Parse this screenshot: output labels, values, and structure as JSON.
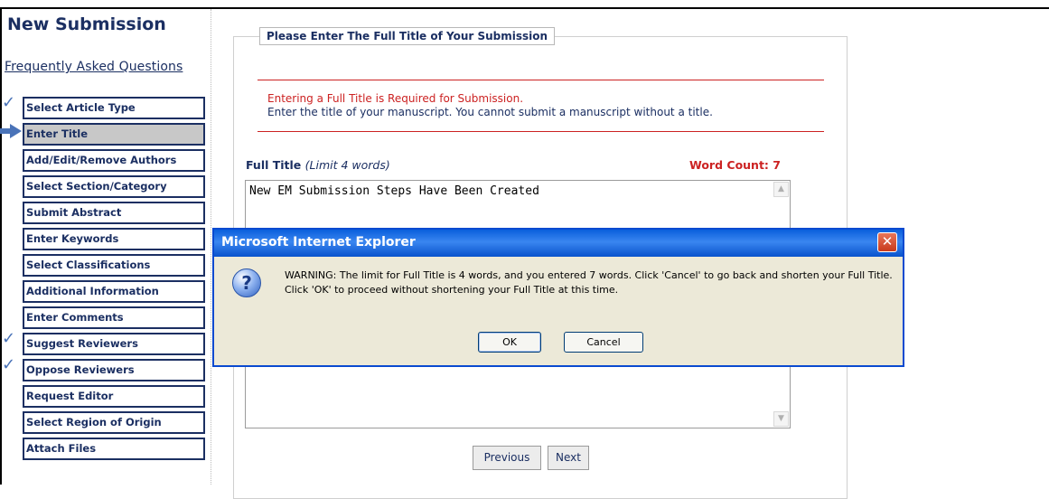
{
  "page": {
    "title": "New Submission",
    "faq_link": "Frequently Asked Questions"
  },
  "sidebar": {
    "steps": [
      {
        "label": "Select Article Type",
        "status": "complete"
      },
      {
        "label": "Enter Title",
        "status": "current"
      },
      {
        "label": "Add/Edit/Remove Authors",
        "status": "pending"
      },
      {
        "label": "Select Section/Category",
        "status": "pending"
      },
      {
        "label": "Submit Abstract",
        "status": "pending"
      },
      {
        "label": "Enter Keywords",
        "status": "pending"
      },
      {
        "label": "Select Classifications",
        "status": "pending"
      },
      {
        "label": "Additional Information",
        "status": "pending"
      },
      {
        "label": "Enter Comments",
        "status": "pending"
      },
      {
        "label": "Suggest Reviewers",
        "status": "complete"
      },
      {
        "label": "Oppose Reviewers",
        "status": "complete"
      },
      {
        "label": "Request Editor",
        "status": "pending"
      },
      {
        "label": "Select Region of Origin",
        "status": "pending"
      },
      {
        "label": "Attach Files",
        "status": "pending"
      }
    ]
  },
  "main": {
    "legend": "Please Enter The Full Title of Your Submission",
    "required_message": "Entering a Full Title is Required for Submission.",
    "info_message": "Enter the title of your manuscript. You cannot submit a manuscript without a title.",
    "field_label": "Full Title",
    "field_limit": "(Limit 4 words)",
    "word_count": "Word Count: 7",
    "title_value": "New EM Submission Steps Have Been Created",
    "previous_button": "Previous",
    "next_button": "Next"
  },
  "dialog": {
    "title": "Microsoft Internet Explorer",
    "icon": "question-icon",
    "message": "WARNING: The limit for Full Title is 4 words, and you entered 7 words. Click 'Cancel' to go back and shorten your Full Title. Click 'OK' to proceed without shortening your Full Title at this time.",
    "ok_button": "OK",
    "cancel_button": "Cancel",
    "close_glyph": "✕"
  },
  "colors": {
    "navy": "#1b2f62",
    "required_red": "#cc2222",
    "check_blue": "#4a73b8",
    "dialog_blue": "#0a4ad0",
    "dialog_bg": "#ece9d8"
  }
}
